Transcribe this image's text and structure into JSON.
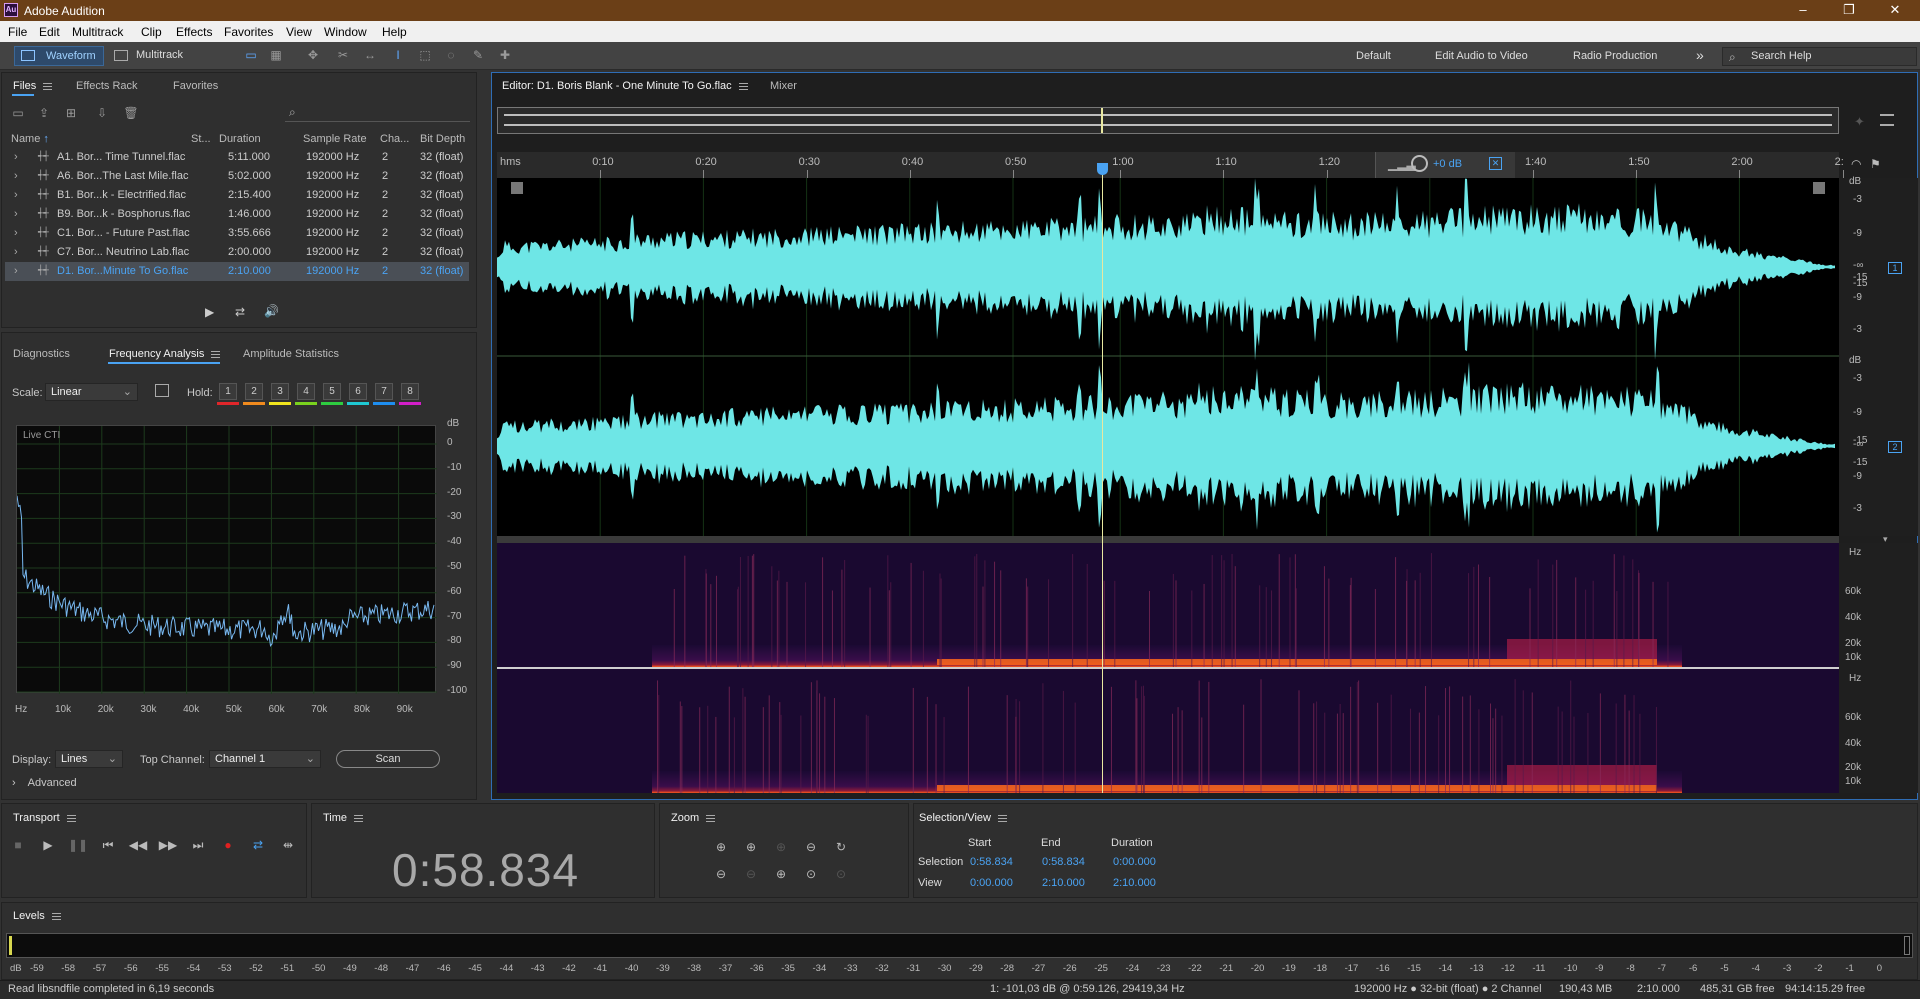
{
  "window": {
    "title": "Adobe Audition",
    "logo": "Au",
    "minimize": "–",
    "maximize": "❐",
    "close": "✕"
  },
  "menu": [
    "File",
    "Edit",
    "Multitrack",
    "Clip",
    "Effects",
    "Favorites",
    "View",
    "Window",
    "Help"
  ],
  "toolbar": {
    "waveform_label": "Waveform",
    "multitrack_label": "Multitrack"
  },
  "workspaces": {
    "default": "Default",
    "edit_audio_to_video": "Edit Audio to Video",
    "radio_production": "Radio Production",
    "overflow": "»"
  },
  "search": {
    "placeholder": "Search Help"
  },
  "files_panel": {
    "tabs": [
      "Files",
      "Effects Rack",
      "Favorites"
    ],
    "columns": [
      "Name",
      "St...",
      "Duration",
      "Sample Rate",
      "Cha...",
      "Bit Depth"
    ],
    "sort_arrow": "↑",
    "rows": [
      {
        "name": "A1. Bor... Time Tunnel.flac",
        "duration": "5:11.000",
        "sample_rate": "192000 Hz",
        "channels": "2",
        "bit_depth": "32 (float)"
      },
      {
        "name": "A6. Bor...The Last Mile.flac",
        "duration": "5:02.000",
        "sample_rate": "192000 Hz",
        "channels": "2",
        "bit_depth": "32 (float)"
      },
      {
        "name": "B1. Bor...k - Electrified.flac",
        "duration": "2:15.400",
        "sample_rate": "192000 Hz",
        "channels": "2",
        "bit_depth": "32 (float)"
      },
      {
        "name": "B9. Bor...k - Bosphorus.flac",
        "duration": "1:46.000",
        "sample_rate": "192000 Hz",
        "channels": "2",
        "bit_depth": "32 (float)"
      },
      {
        "name": "C1. Bor... - Future Past.flac",
        "duration": "3:55.666",
        "sample_rate": "192000 Hz",
        "channels": "2",
        "bit_depth": "32 (float)"
      },
      {
        "name": "C7. Bor... Neutrino Lab.flac",
        "duration": "2:00.000",
        "sample_rate": "192000 Hz",
        "channels": "2",
        "bit_depth": "32 (float)"
      },
      {
        "name": "D1. Bor...Minute To Go.flac",
        "duration": "2:10.000",
        "sample_rate": "192000 Hz",
        "channels": "2",
        "bit_depth": "32 (float)"
      }
    ],
    "selected_index": 6
  },
  "analysis_panel": {
    "tabs": [
      "Diagnostics",
      "Frequency Analysis",
      "Amplitude Statistics"
    ],
    "scale_label": "Scale:",
    "scale_value": "Linear",
    "hold_label": "Hold:",
    "hold_buttons": [
      "1",
      "2",
      "3",
      "4",
      "5",
      "6",
      "7",
      "8"
    ],
    "hold_colors": [
      "#e0262a",
      "#f08a1e",
      "#f0e41e",
      "#7ad21e",
      "#2ecc40",
      "#1ec8d2",
      "#1e8ef0",
      "#d21ec8"
    ],
    "live_cti": "Live CTI",
    "y_ticks": [
      "dB",
      "0",
      "-10",
      "-20",
      "-30",
      "-40",
      "-50",
      "-60",
      "-70",
      "-80",
      "-90",
      "-100"
    ],
    "x_ticks": [
      "Hz",
      "10k",
      "20k",
      "30k",
      "40k",
      "50k",
      "60k",
      "70k",
      "80k",
      "90k"
    ],
    "display_label": "Display:",
    "display_value": "Lines",
    "top_channel_label": "Top Channel:",
    "top_channel_value": "Channel 1",
    "scan_label": "Scan",
    "advanced_label": "Advanced"
  },
  "editor": {
    "tab_title": "Editor: D1. Boris Blank - One Minute To Go.flac",
    "mixer_label": "Mixer",
    "ruler_ticks": [
      "hms",
      "0:10",
      "0:20",
      "0:30",
      "0:40",
      "0:50",
      "1:00",
      "1:10",
      "1:20",
      "1:30",
      "1:40",
      "1:50",
      "2:00",
      "2:"
    ],
    "gain_label": "+0 dB",
    "channel_db_ticks": [
      "dB",
      "-3",
      "-9",
      "-15",
      "-∞",
      "-15",
      "-9",
      "-3"
    ],
    "channel_numbers": [
      "1",
      "2"
    ],
    "spectral_ticks": [
      "Hz",
      "60k",
      "40k",
      "20k",
      "10k"
    ],
    "playhead_time": "0:58.834"
  },
  "transport": {
    "title": "Transport"
  },
  "time_panel": {
    "title": "Time",
    "value": "0:58.834"
  },
  "zoom_panel": {
    "title": "Zoom"
  },
  "selection_view": {
    "title": "Selection/View",
    "headers": [
      "Start",
      "End",
      "Duration"
    ],
    "rows": [
      {
        "label": "Selection",
        "start": "0:58.834",
        "end": "0:58.834",
        "duration": "0:00.000"
      },
      {
        "label": "View",
        "start": "0:00.000",
        "end": "2:10.000",
        "duration": "2:10.000"
      }
    ]
  },
  "levels": {
    "title": "Levels",
    "ticks": [
      "dB",
      "-59",
      "-58",
      "-57",
      "-56",
      "-55",
      "-54",
      "-53",
      "-52",
      "-51",
      "-50",
      "-49",
      "-48",
      "-47",
      "-46",
      "-45",
      "-44",
      "-43",
      "-42",
      "-41",
      "-40",
      "-39",
      "-38",
      "-37",
      "-36",
      "-35",
      "-34",
      "-33",
      "-32",
      "-31",
      "-30",
      "-29",
      "-28",
      "-27",
      "-26",
      "-25",
      "-24",
      "-23",
      "-22",
      "-21",
      "-20",
      "-19",
      "-18",
      "-17",
      "-16",
      "-15",
      "-14",
      "-13",
      "-12",
      "-11",
      "-10",
      "-9",
      "-8",
      "-7",
      "-6",
      "-5",
      "-4",
      "-3",
      "-2",
      "-1",
      "0"
    ]
  },
  "status_bar": {
    "message": "Read libsndfile completed in 6,19 seconds",
    "cursor": "1: -101,03 dB @ 0:59.126, 29419,34 Hz",
    "format": "192000 Hz ● 32-bit (float) ● 2 Channel",
    "size": "190,43 MB",
    "duration": "2:10.000",
    "free": "485,31 GB free",
    "time_free": "94:14:15.29 free"
  },
  "colors": {
    "waveform": "#6ee6e6",
    "playhead": "#e8e8a0",
    "selection_text": "#4aa3f3",
    "accent_blue": "#2f6db5"
  }
}
